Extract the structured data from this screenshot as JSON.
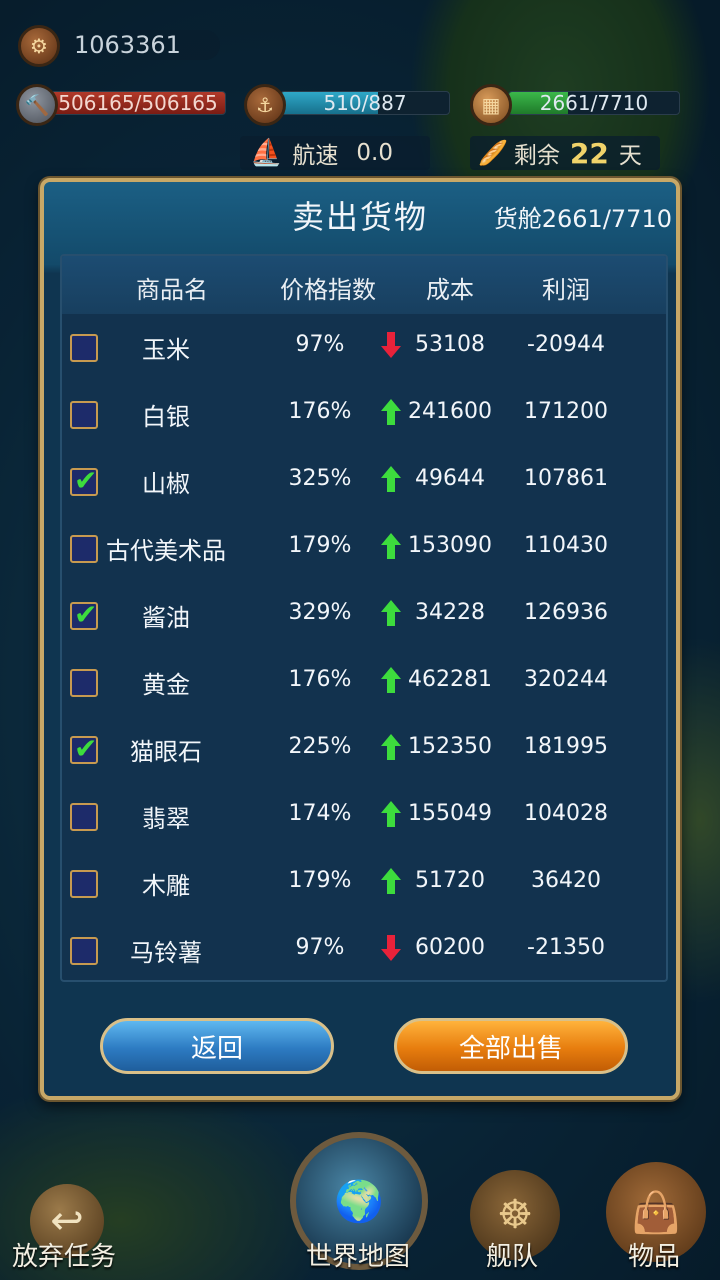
{
  "hud": {
    "gold": "1063361",
    "durability": "506165/506165",
    "crew": "510/887",
    "cargo_bar": "2661/7710",
    "speed_label": "航速",
    "speed_value": "0.0",
    "remain_label": "剩余",
    "remain_days": "22",
    "remain_unit": "天",
    "crew_fill": 0.575,
    "cargo_fill": 0.345
  },
  "dialog": {
    "title": "卖出货物",
    "cargo": "货舱2661/7710",
    "headers": {
      "name": "商品名",
      "price_index": "价格指数",
      "cost": "成本",
      "profit": "利润"
    },
    "rows": [
      {
        "name": "玉米",
        "checked": false,
        "pct": "97%",
        "trend": "down",
        "cost": "53108",
        "profit": "-20944"
      },
      {
        "name": "白银",
        "checked": false,
        "pct": "176%",
        "trend": "up",
        "cost": "241600",
        "profit": "171200"
      },
      {
        "name": "山椒",
        "checked": true,
        "pct": "325%",
        "trend": "up",
        "cost": "49644",
        "profit": "107861"
      },
      {
        "name": "古代美术品",
        "checked": false,
        "pct": "179%",
        "trend": "up",
        "cost": "153090",
        "profit": "110430"
      },
      {
        "name": "酱油",
        "checked": true,
        "pct": "329%",
        "trend": "up",
        "cost": "34228",
        "profit": "126936"
      },
      {
        "name": "黄金",
        "checked": false,
        "pct": "176%",
        "trend": "up",
        "cost": "462281",
        "profit": "320244"
      },
      {
        "name": "猫眼石",
        "checked": true,
        "pct": "225%",
        "trend": "up",
        "cost": "152350",
        "profit": "181995"
      },
      {
        "name": "翡翠",
        "checked": false,
        "pct": "174%",
        "trend": "up",
        "cost": "155049",
        "profit": "104028"
      },
      {
        "name": "木雕",
        "checked": false,
        "pct": "179%",
        "trend": "up",
        "cost": "51720",
        "profit": "36420"
      },
      {
        "name": "马铃薯",
        "checked": false,
        "pct": "97%",
        "trend": "down",
        "cost": "60200",
        "profit": "-21350"
      }
    ],
    "back_label": "返回",
    "sell_all_label": "全部出售"
  },
  "nav": {
    "abandon": "放弃任务",
    "world_map": "世界地图",
    "fleet": "舰队",
    "items": "物品"
  },
  "colors": {
    "up": "#3ddc3d",
    "down": "#e8223a",
    "frame": "#c7a867"
  }
}
